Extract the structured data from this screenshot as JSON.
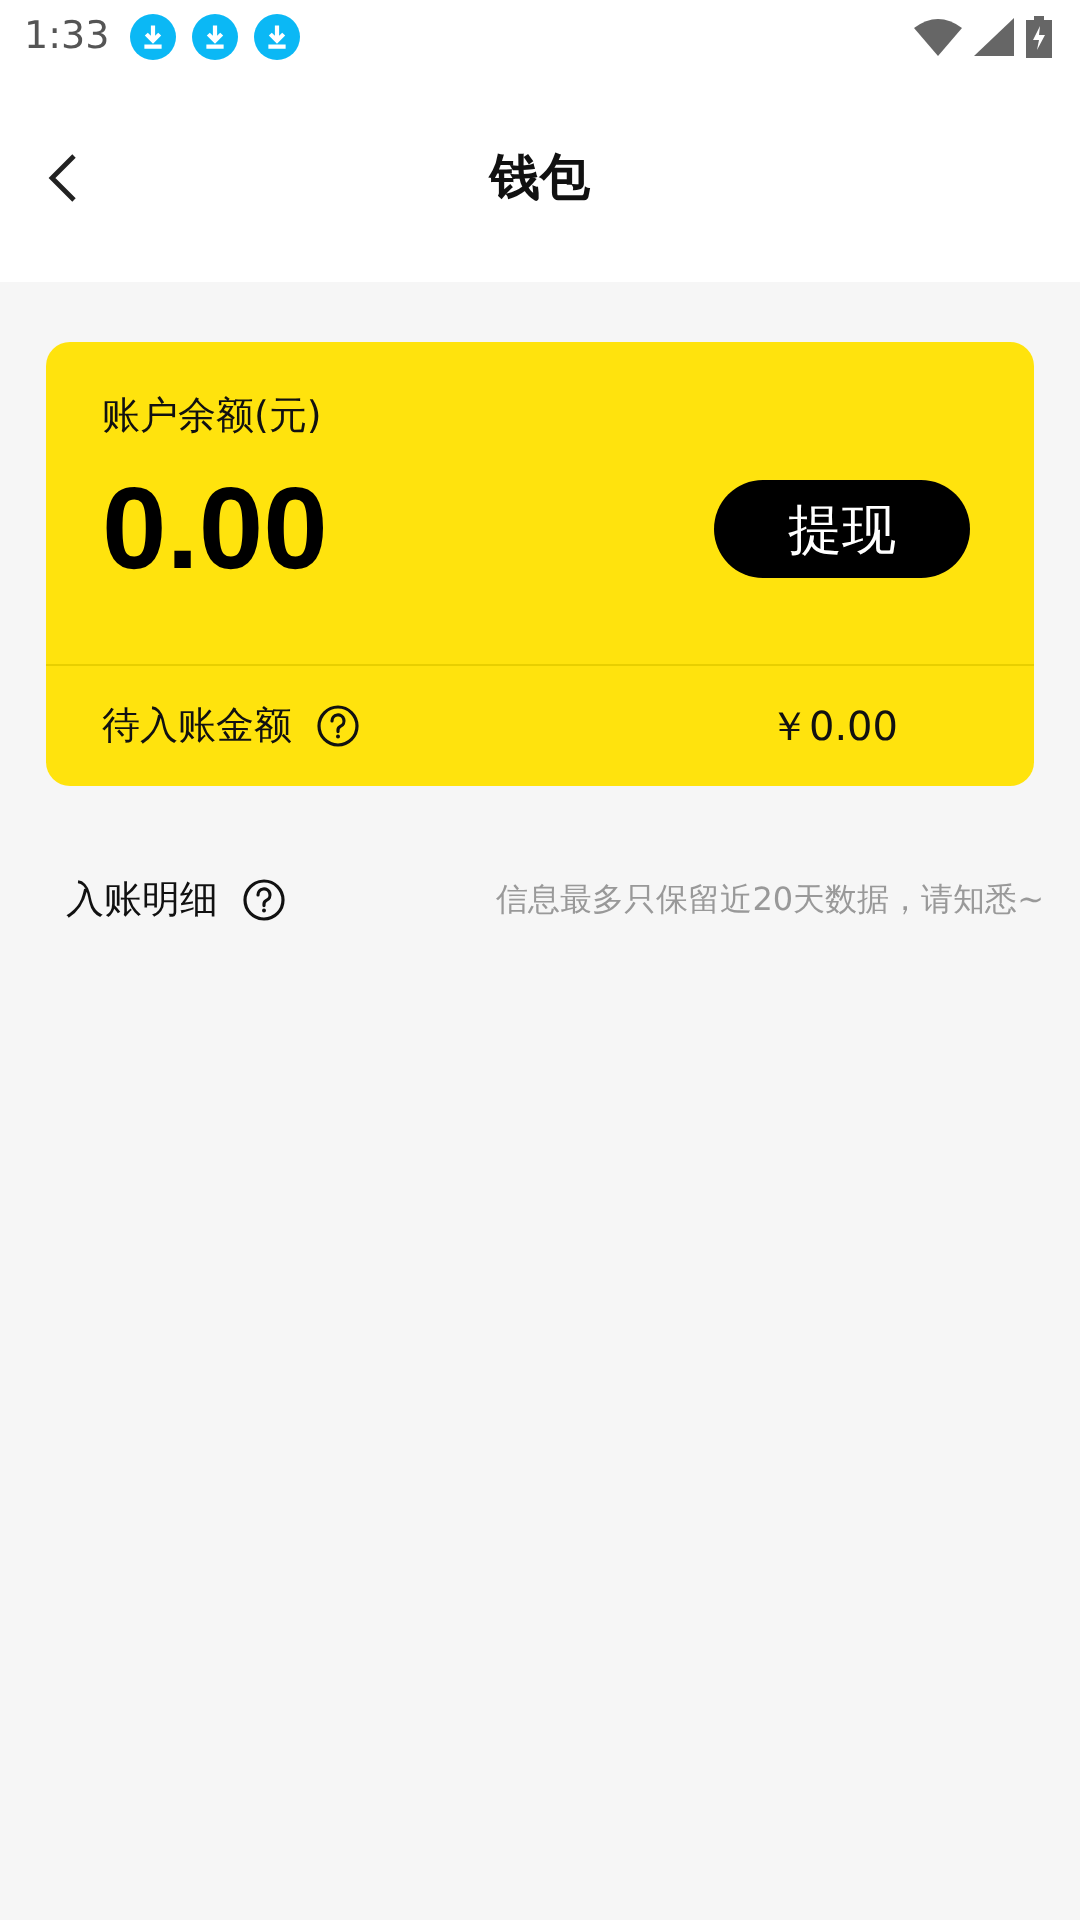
{
  "status_bar": {
    "time": "1:33",
    "notifications": [
      {
        "kind": "download"
      },
      {
        "kind": "download"
      },
      {
        "kind": "download"
      }
    ]
  },
  "header": {
    "title": "钱包"
  },
  "balance_card": {
    "label": "账户余额(元)",
    "amount": "0.00",
    "withdraw_button": "提现",
    "pending_label": "待入账金额",
    "pending_amount": "￥0.00"
  },
  "records": {
    "title": "入账明细",
    "notice": "信息最多只保留近20天数据，请知悉~"
  }
}
